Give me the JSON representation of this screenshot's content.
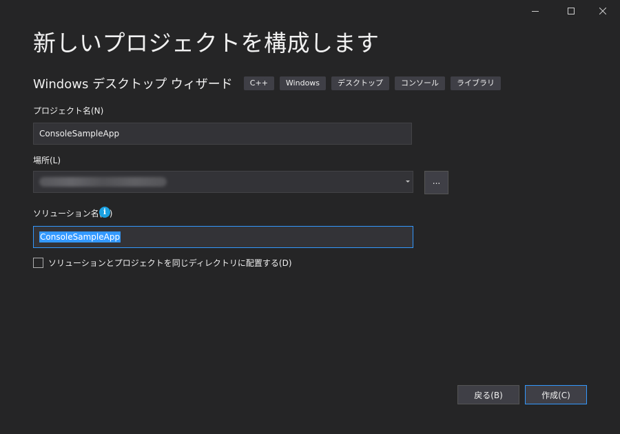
{
  "window": {
    "controls": [
      "minimize",
      "maximize",
      "close"
    ]
  },
  "title": "新しいプロジェクトを構成します",
  "template": {
    "name": "Windows デスクトップ ウィザード",
    "tags": [
      "C++",
      "Windows",
      "デスクトップ",
      "コンソール",
      "ライブラリ"
    ]
  },
  "project_name": {
    "label": "プロジェクト名(N)",
    "value": "ConsoleSampleApp"
  },
  "location": {
    "label": "場所(L)",
    "browse_label": "..."
  },
  "solution_name": {
    "label": "ソリューション名(M)",
    "info_glyph": "i",
    "value": "ConsoleSampleApp"
  },
  "same_directory": {
    "label": "ソリューションとプロジェクトを同じディレクトリに配置する(D)",
    "checked": false
  },
  "footer": {
    "back_label": "戻る(B)",
    "create_label": "作成(C)"
  },
  "colors": {
    "background": "#252526",
    "accent": "#3399ff",
    "info": "#1ba1e2"
  }
}
